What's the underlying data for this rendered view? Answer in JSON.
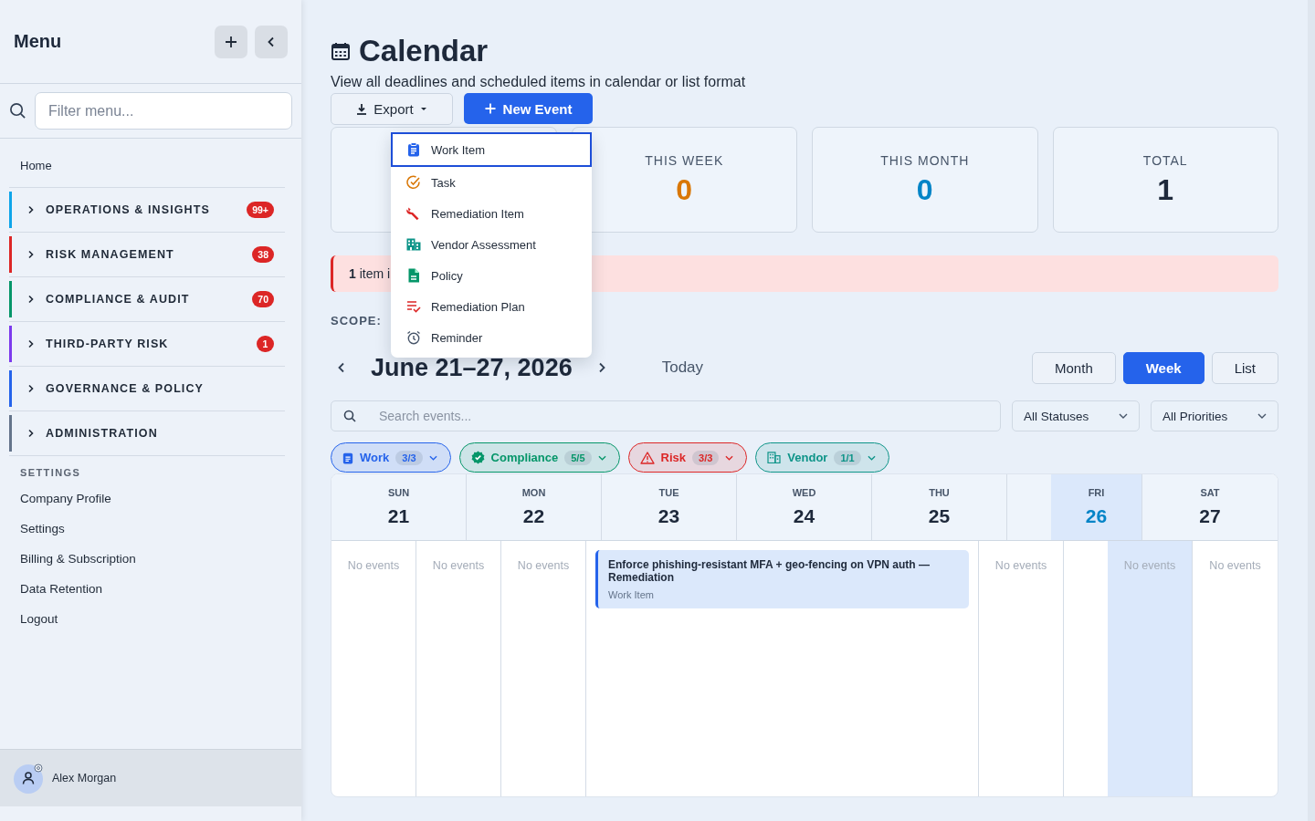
{
  "sidebar": {
    "title": "Menu",
    "filter": {
      "placeholder": "Filter menu..."
    },
    "home": "Home",
    "sections": [
      {
        "label": "OPERATIONS & INSIGHTS",
        "badge": "99+",
        "color": "#0ea5e9",
        "expanded": false
      },
      {
        "label": "RISK MANAGEMENT",
        "badge": "38",
        "color": "#dc2626",
        "expanded": false
      },
      {
        "label": "COMPLIANCE & AUDIT",
        "badge": "70",
        "color": "#059669",
        "expanded": false
      },
      {
        "label": "THIRD-PARTY RISK",
        "badge": "1",
        "color": "#7c3aed",
        "expanded": false
      },
      {
        "label": "GOVERNANCE & POLICY",
        "color": "#2563eb",
        "expanded": false
      },
      {
        "label": "ADMINISTRATION",
        "color": "#64748b",
        "expanded": false
      }
    ],
    "settings_heading": "SETTINGS",
    "settings_items": [
      "Company Profile",
      "Settings",
      "Billing & Subscription",
      "Data Retention",
      "Logout"
    ],
    "user": {
      "name": "Alex Morgan"
    }
  },
  "page": {
    "title": "Calendar",
    "subtitle": "View all deadlines and scheduled items in calendar or list format",
    "export_button": "Export",
    "new_button": "New Event",
    "new_menu": [
      {
        "label": "Work Item",
        "kind": "work",
        "selected": true
      },
      {
        "label": "Task",
        "kind": "task",
        "selected": false
      },
      {
        "label": "Remediation Item",
        "kind": "remediation",
        "selected": false
      },
      {
        "label": "Vendor Assessment",
        "kind": "vendor",
        "selected": false
      },
      {
        "label": "Policy",
        "kind": "policy",
        "selected": false
      },
      {
        "label": "Remediation Plan",
        "kind": "plan",
        "selected": false
      },
      {
        "label": "Reminder",
        "kind": "reminder",
        "selected": false
      }
    ],
    "stats": [
      {
        "label": "THIS WEEK",
        "value": "0",
        "color": "#d97706"
      },
      {
        "label": "THIS MONTH",
        "value": "0",
        "color": "#0284c7"
      },
      {
        "label": "TOTAL",
        "value": "1",
        "color": "#1e293b"
      }
    ],
    "alert": "1 item i",
    "scope_label": "SCOPE:",
    "range": "June 21–27, 2026",
    "today_button": "Today",
    "views": [
      {
        "label": "Month",
        "selected": false
      },
      {
        "label": "Week",
        "selected": true
      },
      {
        "label": "List",
        "selected": false
      }
    ],
    "search": {
      "placeholder": "Search events..."
    },
    "status_filter": "All Statuses",
    "priority_filter": "All Priorities",
    "chips": [
      {
        "label": "Work",
        "count": "3/3",
        "kind": "work",
        "color": "#2563eb"
      },
      {
        "label": "Compliance",
        "count": "5/5",
        "kind": "compliance",
        "color": "#059669"
      },
      {
        "label": "Risk",
        "count": "3/3",
        "kind": "risk",
        "color": "#dc2626"
      },
      {
        "label": "Vendor",
        "count": "1/1",
        "kind": "vendor",
        "color": "#0d9488"
      }
    ],
    "days": [
      {
        "dow": "SUN",
        "date": "21",
        "today": false,
        "empty": "No events"
      },
      {
        "dow": "MON",
        "date": "22",
        "today": false,
        "empty": "No events"
      },
      {
        "dow": "TUE",
        "date": "23",
        "today": false,
        "empty": "No events"
      },
      {
        "dow": "WED",
        "date": "24",
        "today": false,
        "events": [
          {
            "title": "Enforce phishing-resistant MFA + geo-fencing on VPN auth — Remediation",
            "type": "Work Item"
          }
        ]
      },
      {
        "dow": "THU",
        "date": "25",
        "today": false,
        "empty": "No events"
      },
      {
        "dow": "FRI",
        "date": "26",
        "today": true,
        "empty": "No events"
      },
      {
        "dow": "SAT",
        "date": "27",
        "today": false,
        "empty": "No events"
      }
    ]
  }
}
